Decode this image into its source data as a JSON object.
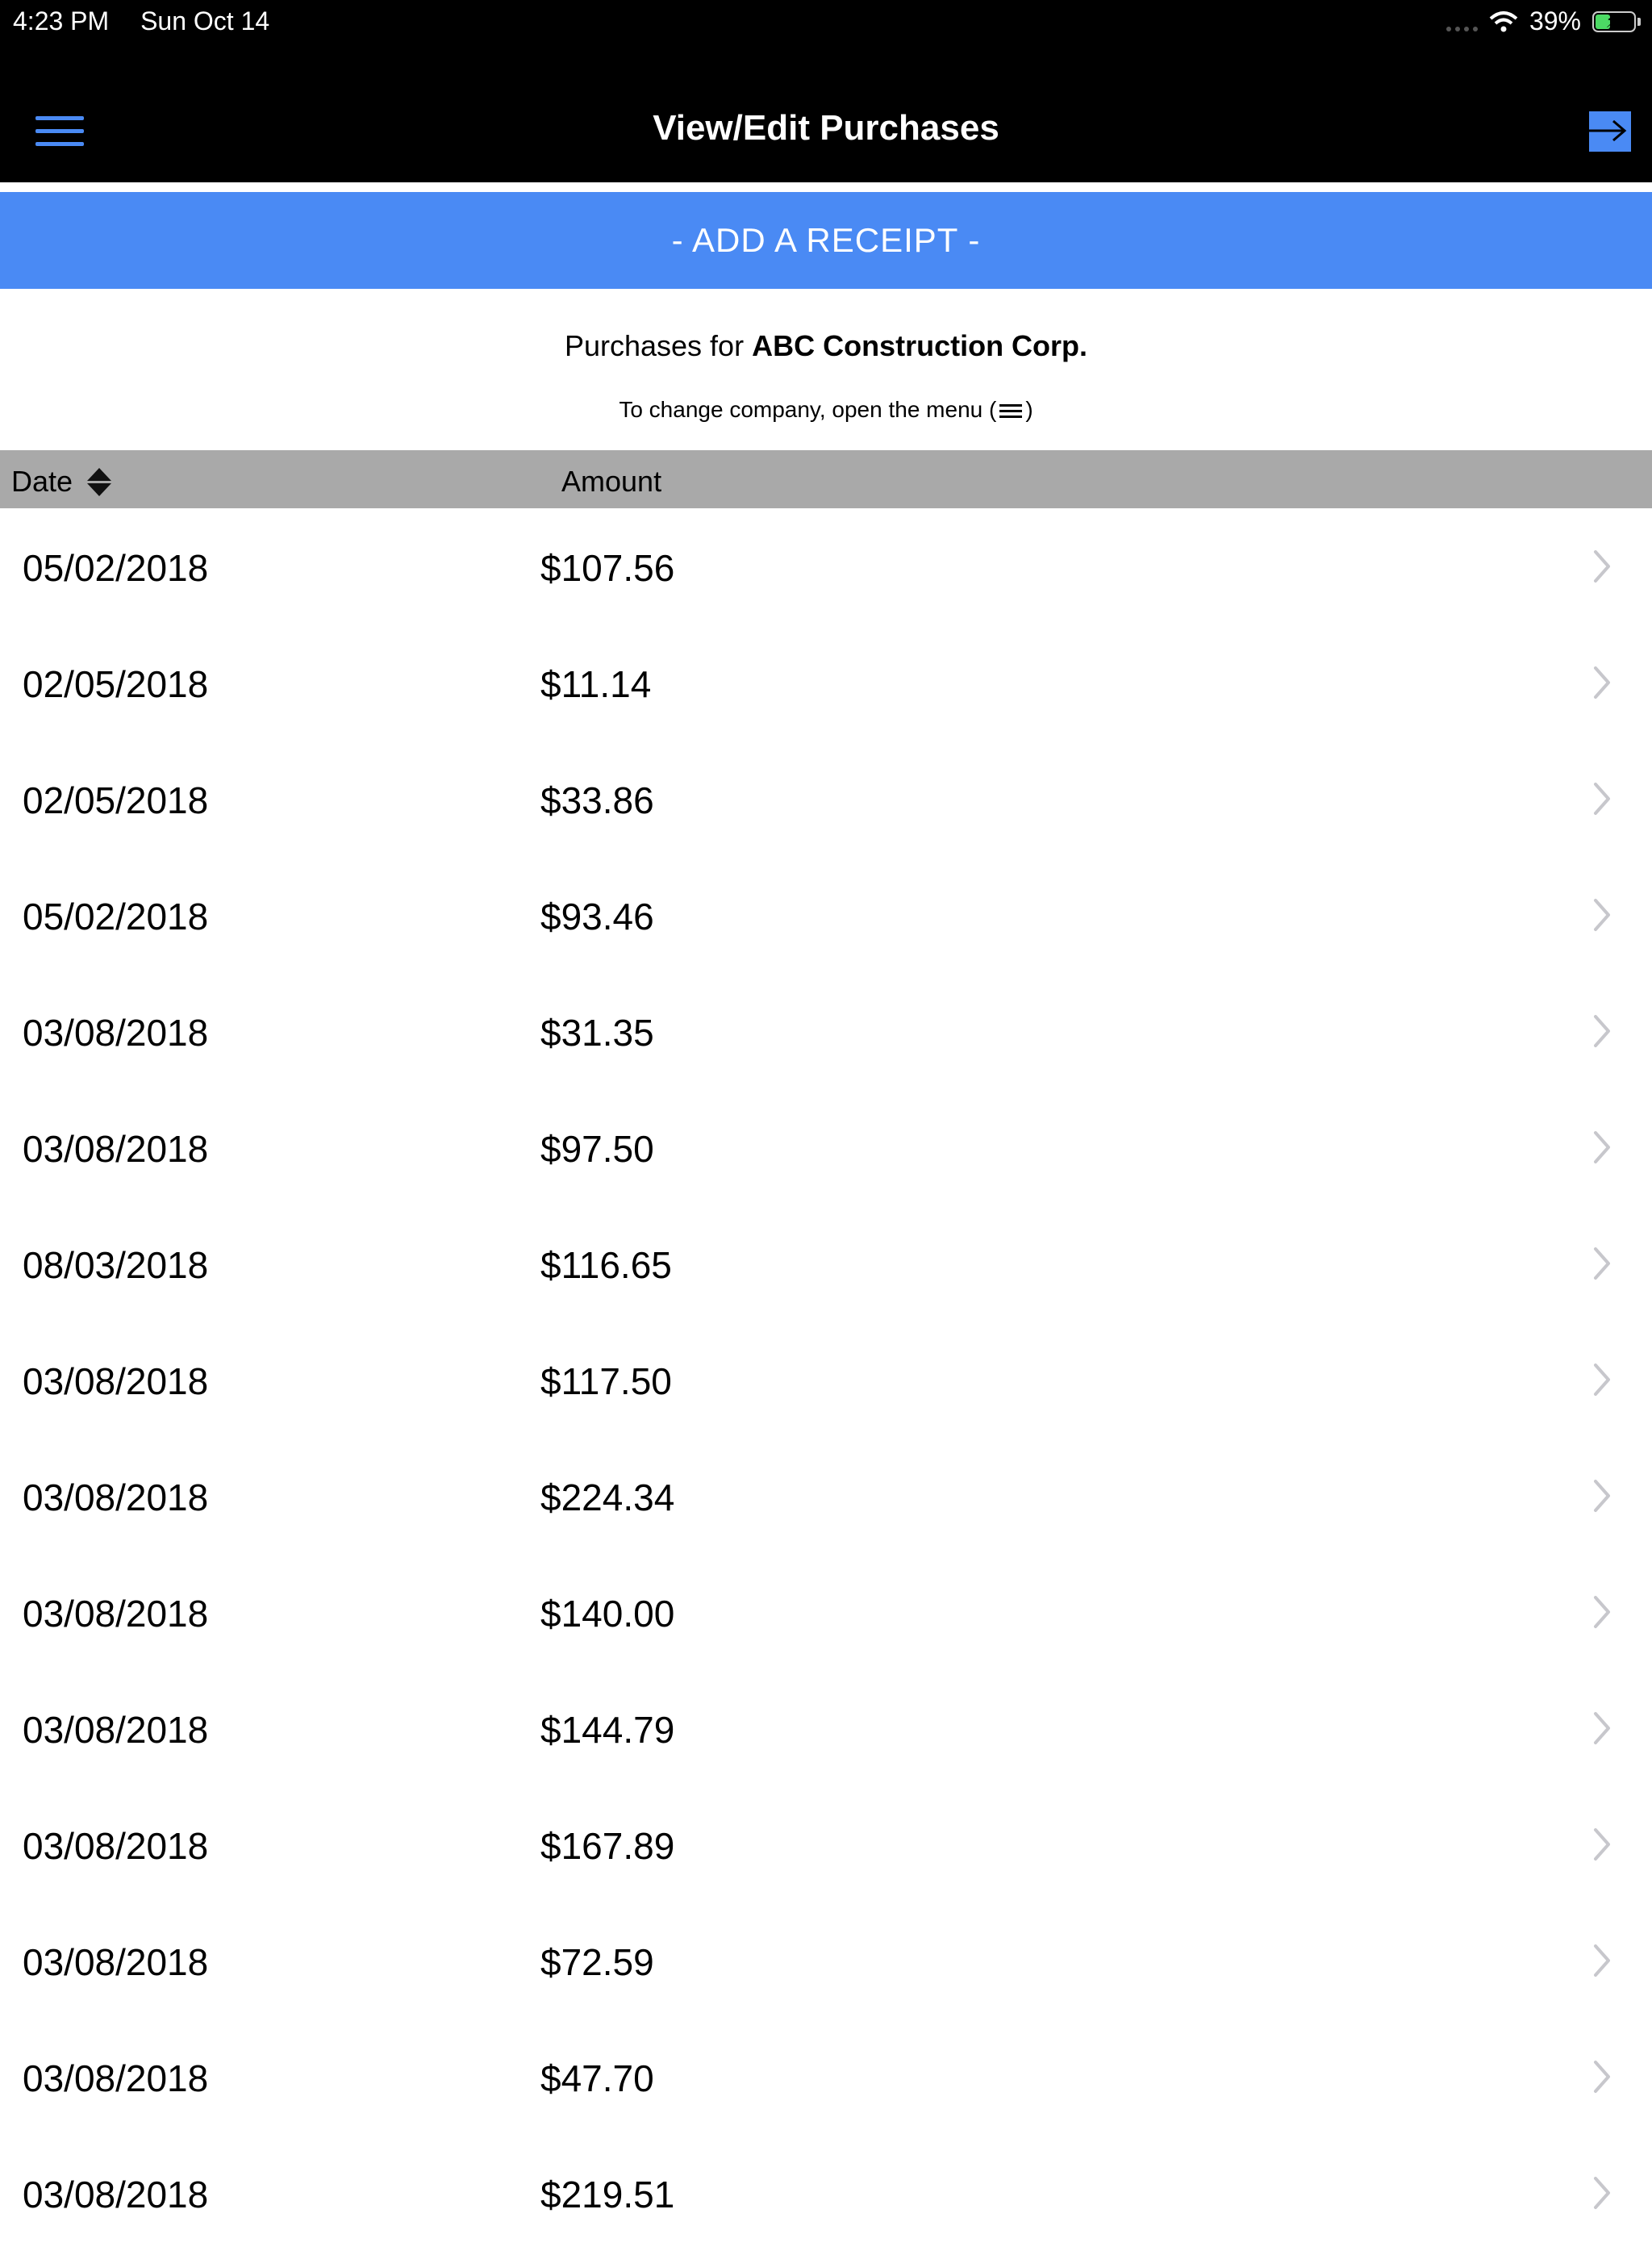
{
  "status_bar": {
    "time": "4:23 PM",
    "date": "Sun Oct 14",
    "battery_text": "39%",
    "battery_level": 0.39
  },
  "nav": {
    "title": "View/Edit Purchases",
    "menu_icon": "hamburger-menu-icon",
    "logout_icon": "logout-arrow-icon"
  },
  "add_receipt_label": "- ADD A RECEIPT -",
  "company": {
    "prefix": "Purchases for",
    "name": "ABC Construction Corp.",
    "hint_before": "To change company, open the menu (",
    "hint_after": ")"
  },
  "table": {
    "headers": {
      "date": "Date",
      "amount": "Amount"
    },
    "rows": [
      {
        "date": "05/02/2018",
        "amount": "$107.56"
      },
      {
        "date": "02/05/2018",
        "amount": "$11.14"
      },
      {
        "date": "02/05/2018",
        "amount": "$33.86"
      },
      {
        "date": "05/02/2018",
        "amount": "$93.46"
      },
      {
        "date": "03/08/2018",
        "amount": "$31.35"
      },
      {
        "date": "03/08/2018",
        "amount": "$97.50"
      },
      {
        "date": "08/03/2018",
        "amount": "$116.65"
      },
      {
        "date": "03/08/2018",
        "amount": "$117.50"
      },
      {
        "date": "03/08/2018",
        "amount": "$224.34"
      },
      {
        "date": "03/08/2018",
        "amount": "$140.00"
      },
      {
        "date": "03/08/2018",
        "amount": "$144.79"
      },
      {
        "date": "03/08/2018",
        "amount": "$167.89"
      },
      {
        "date": "03/08/2018",
        "amount": "$72.59"
      },
      {
        "date": "03/08/2018",
        "amount": "$47.70"
      },
      {
        "date": "03/08/2018",
        "amount": "$219.51"
      }
    ]
  },
  "colors": {
    "accent": "#4a8af4",
    "header_bg": "#000000",
    "table_header_bg": "#a9a9a9",
    "chevron": "#c7c7cc"
  }
}
